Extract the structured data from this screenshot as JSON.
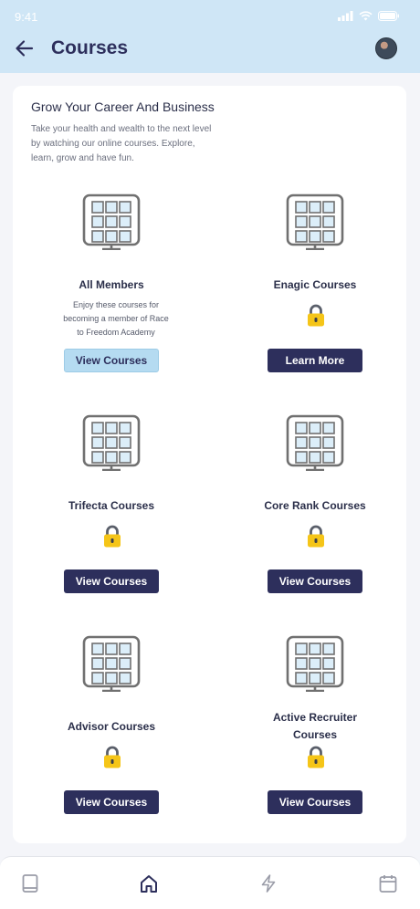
{
  "status": {
    "time": "9:41"
  },
  "header": {
    "title": "Courses"
  },
  "intro": {
    "title": "Grow Your Career And Business",
    "description": "Take your health and wealth to the next level by watching our online courses. Explore, learn, grow and have fun."
  },
  "courses": [
    {
      "name": "All Members",
      "description": "Enjoy these courses for becoming a member of Race to Freedom Academy",
      "locked": false,
      "button": "View Courses",
      "button_style": "light"
    },
    {
      "name": "Enagic Courses",
      "description": "",
      "locked": true,
      "button": "Learn More",
      "button_style": "dark"
    },
    {
      "name": "Trifecta Courses",
      "description": "",
      "locked": true,
      "button": "View Courses",
      "button_style": "dark"
    },
    {
      "name": "Core Rank Courses",
      "description": "",
      "locked": true,
      "button": "View Courses",
      "button_style": "dark"
    },
    {
      "name": "Advisor Courses",
      "description": "",
      "locked": true,
      "button": "View Courses",
      "button_style": "dark"
    },
    {
      "name": "Active Recruiter Courses",
      "description": "",
      "locked": true,
      "button": "View Courses",
      "button_style": "dark"
    }
  ],
  "bottom_nav": [
    {
      "icon": "book-icon",
      "active": false
    },
    {
      "icon": "home-icon",
      "active": true
    },
    {
      "icon": "lightning-icon",
      "active": false
    },
    {
      "icon": "calendar-icon",
      "active": false
    }
  ],
  "colors": {
    "header_bg": "#cfe6f6",
    "primary": "#2d2f5c",
    "light_button": "#b5dbf1",
    "lock": "#f5c518"
  }
}
